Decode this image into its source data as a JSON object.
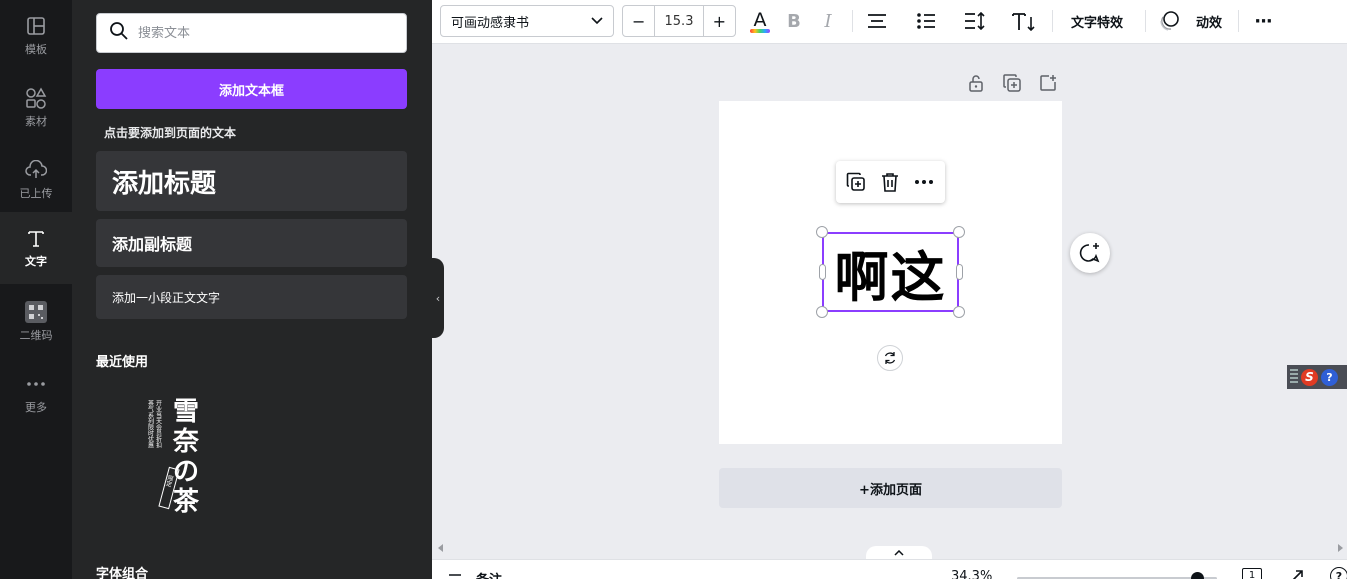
{
  "rail": {
    "items": [
      {
        "label": "模板",
        "icon": "template-icon"
      },
      {
        "label": "素材",
        "icon": "elements-icon"
      },
      {
        "label": "已上传",
        "icon": "upload-cloud-icon"
      },
      {
        "label": "文字",
        "icon": "text-icon"
      },
      {
        "label": "二维码",
        "icon": "qrcode-icon"
      },
      {
        "label": "更多",
        "icon": "more-icon"
      }
    ],
    "active_index": 3
  },
  "panel": {
    "search_placeholder": "搜索文本",
    "add_textbox": "添加文本框",
    "hint": "点击要添加到页面的文本",
    "heading": "添加标题",
    "subheading": "添加副标题",
    "body": "添加一小段正文文字",
    "recent_title": "最近使用",
    "combo_title": "字体组合",
    "recent_thumb": {
      "title_chars": "雪奈の茶",
      "side_text": "开业当天会员折扣",
      "stamp": "限定"
    }
  },
  "toolbar": {
    "font": "可画动感隶书",
    "minus": "−",
    "font_size": "15.3",
    "plus": "+",
    "text_effects": "文字特效",
    "animate": "动效",
    "more": "···",
    "text_color": "#0e1318"
  },
  "canvas": {
    "text": "啊这",
    "add_page": "+添加页面",
    "selection_color": "#8b3dff"
  },
  "footer": {
    "notes": "备注",
    "zoom": "34.3%",
    "zoom_fraction": 0.9,
    "page_number": "1"
  },
  "ime": {
    "s": "S",
    "help": "?"
  },
  "colors": {
    "accent": "#8b3dff",
    "rail_bg": "#18191b",
    "panel_bg": "#252627",
    "canvas_bg": "#ebecf0"
  }
}
